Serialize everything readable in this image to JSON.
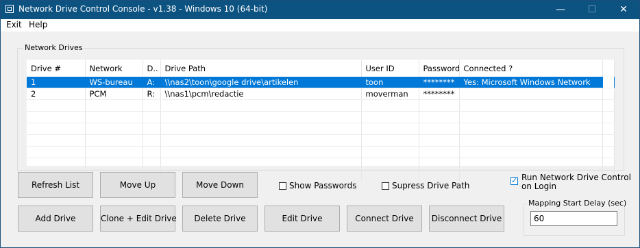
{
  "window": {
    "title": "Network Drive Control Console - v1.38 - Windows 10  (64-bit)",
    "minimize_glyph": "—",
    "maximize_glyph": "☐",
    "close_glyph": "✕"
  },
  "menu": {
    "items": [
      "Exit",
      "Help"
    ]
  },
  "drives_group": {
    "label": "Network Drives"
  },
  "table": {
    "columns": [
      "Drive #",
      "Network",
      "D..",
      "Drive Path",
      "User ID",
      "Password",
      "Connected ?"
    ],
    "rows": [
      [
        "1",
        "WS-bureau",
        "A:",
        "\\\\nas2\\toon\\google drive\\artikelen",
        "toon",
        "********",
        "Yes: Microsoft Windows Network"
      ],
      [
        "2",
        "PCM",
        "R:",
        "\\\\nas1\\pcm\\redactie",
        "moverman",
        "********",
        ""
      ]
    ],
    "selected_row": 0
  },
  "buttons": {
    "refresh": "Refresh List",
    "move_up": "Move Up",
    "move_down": "Move Down",
    "add": "Add Drive",
    "clone_edit": "Clone + Edit Drive",
    "delete": "Delete Drive",
    "edit": "Edit Drive",
    "connect": "Connect Drive",
    "disconnect": "Disconnect Drive"
  },
  "options": {
    "show_passwords": {
      "label": "Show Passwords",
      "checked": false
    },
    "supress_drive_path": {
      "label": "Supress Drive Path",
      "checked": false
    },
    "run_on_login": {
      "label_line1": "Run Network Drive Control",
      "label_line2": "on Login",
      "checked": true
    }
  },
  "delay": {
    "label": "Mapping Start Delay (sec)",
    "value": "60"
  }
}
